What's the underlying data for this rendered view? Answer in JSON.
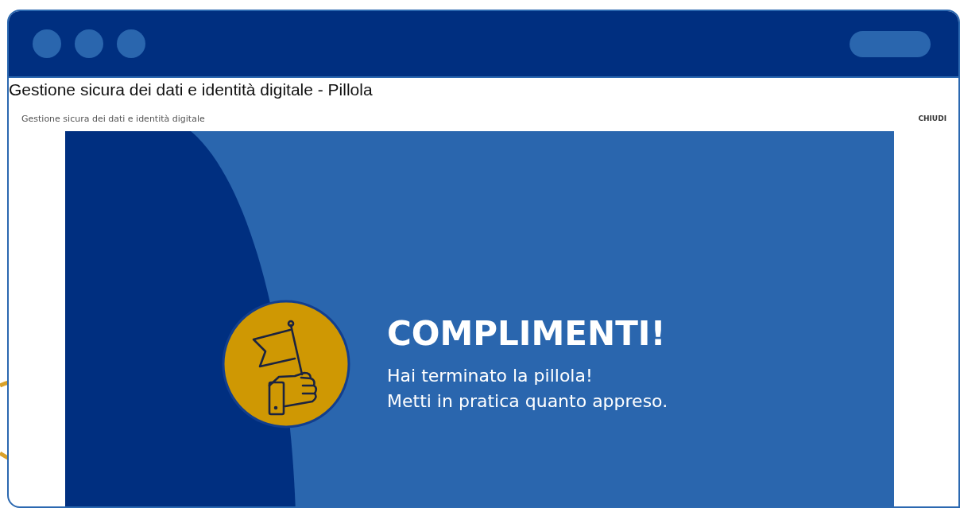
{
  "page_title": "Gestione sicura dei dati e identità digitale - Pillola",
  "course_title": "Gestione sicura dei dati e identità digitale",
  "close_link": "CHIUDI",
  "slide": {
    "heading": "COMPLIMENTI!",
    "lines": [
      "Hai terminato la pillola!",
      "Metti in pratica quanto appreso."
    ]
  }
}
